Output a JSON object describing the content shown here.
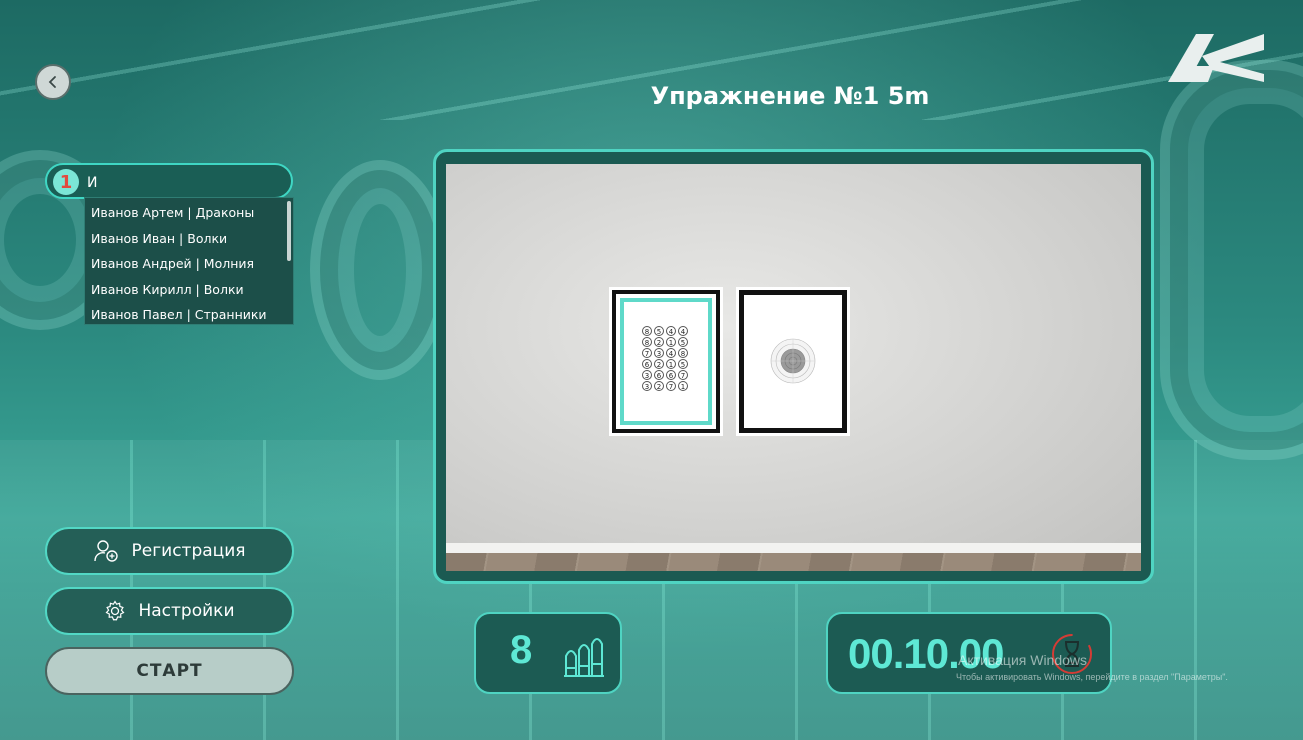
{
  "header": {
    "title": "Упражнение №1 5m"
  },
  "search": {
    "badge": "1",
    "value": "И",
    "suggestions": [
      "Иванов Артем | Драконы",
      "Иванов Иван | Волки",
      "Иванов Андрей | Молния",
      "Иванов Кирилл | Волки",
      "Иванов Павел | Странники"
    ]
  },
  "buttons": {
    "registration": "Регистрация",
    "settings": "Настройки",
    "start": "СТАРТ"
  },
  "targets": {
    "number_grid": [
      "8",
      "5",
      "4",
      "4",
      "8",
      "2",
      "1",
      "5",
      "7",
      "3",
      "4",
      "8",
      "6",
      "2",
      "1",
      "5",
      "3",
      "6",
      "6",
      "7",
      "3",
      "2",
      "7",
      "1"
    ]
  },
  "counters": {
    "shots": "8",
    "timer": "00.10.00"
  },
  "watermark": {
    "line1": "Активация Windows",
    "line2": "Чтобы активировать Windows, перейдите в раздел \"Параметры\"."
  },
  "icons": {
    "back": "chevron-left-icon",
    "registration": "add-user-icon",
    "settings": "gear-icon",
    "shots": "bullets-icon",
    "timer": "hourglass-icon"
  },
  "colors": {
    "accent": "#4fd4c2",
    "counter_text": "#5ee8d5",
    "badge_text": "#e2493d"
  }
}
